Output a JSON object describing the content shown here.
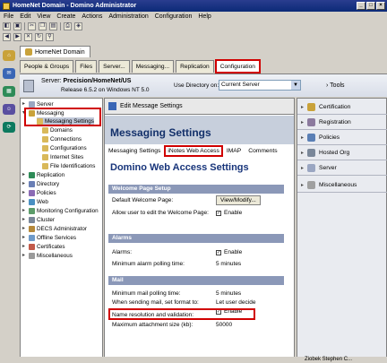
{
  "window": {
    "title": "HomeNet Domain - Domino Administrator"
  },
  "menu": [
    "File",
    "Edit",
    "View",
    "Create",
    "Actions",
    "Administration",
    "Configuration",
    "Help"
  ],
  "doc_tab": {
    "label": "HomeNet Domain"
  },
  "tabs": [
    {
      "label": "People & Groups"
    },
    {
      "label": "Files"
    },
    {
      "label": "Server..."
    },
    {
      "label": "Messaging..."
    },
    {
      "label": "Replication"
    },
    {
      "label": "Configuration"
    }
  ],
  "server": {
    "label": "Server:",
    "name": "Precision/HomeNet/US",
    "release": "Release 6.5.2 on Windows NT 5.0",
    "use_directory_label": "Use Directory on:",
    "use_directory_value": "Current Server",
    "tools_label": "Tools"
  },
  "tree": [
    {
      "label": "Server"
    },
    {
      "label": "Messaging"
    },
    {
      "label": "Messaging Settings"
    },
    {
      "label": "Domains"
    },
    {
      "label": "Connections"
    },
    {
      "label": "Configurations"
    },
    {
      "label": "Internet Sites"
    },
    {
      "label": "File Identifications"
    },
    {
      "label": "Replication"
    },
    {
      "label": "Directory"
    },
    {
      "label": "Policies"
    },
    {
      "label": "Web"
    },
    {
      "label": "Monitoring Configuration"
    },
    {
      "label": "Cluster"
    },
    {
      "label": "DECS Administrator"
    },
    {
      "label": "Offline Services"
    },
    {
      "label": "Certificates"
    },
    {
      "label": "Miscellaneous"
    }
  ],
  "editor": {
    "header": "Edit Message Settings",
    "title": "Messaging Settings",
    "subtabs": [
      "Messaging Settings",
      "iNotes Web Access",
      "IMAP",
      "Comments"
    ],
    "big_title": "Domino Web Access Settings",
    "sections": {
      "welcome": "Welcome Page Setup",
      "alarms": "Alarms",
      "mail": "Mail"
    },
    "fields": {
      "default_welcome": {
        "label": "Default Welcome Page:",
        "button": "View/Modify..."
      },
      "allow_edit": {
        "label": "Allow user to edit the Welcome Page:",
        "value": "Enable"
      },
      "alarms": {
        "label": "Alarms:",
        "value": "Enable"
      },
      "min_alarm": {
        "label": "Minimum alarm polling time:",
        "value": "5 minutes"
      },
      "min_mail": {
        "label": "Minimum mail polling time:",
        "value": "5 minutes"
      },
      "send_format": {
        "label": "When sending mail, set format to:",
        "value": "Let user decide"
      },
      "name_resolution": {
        "label": "Name resolution and validation:",
        "value": "Enable"
      },
      "max_attach": {
        "label": "Maximum attachment size (kb):",
        "value": "50000"
      }
    }
  },
  "right_panel": [
    {
      "label": "Certification"
    },
    {
      "label": "Registration"
    },
    {
      "label": "Policies"
    },
    {
      "label": "Hosted Org"
    },
    {
      "label": "Server"
    },
    {
      "label": "Miscellaneous"
    }
  ],
  "status": {
    "user": "Ziobek Stephen C..."
  },
  "colors": {
    "highlight": "#d00000",
    "title_blue": "#17347a",
    "section": "#8b98b8"
  }
}
